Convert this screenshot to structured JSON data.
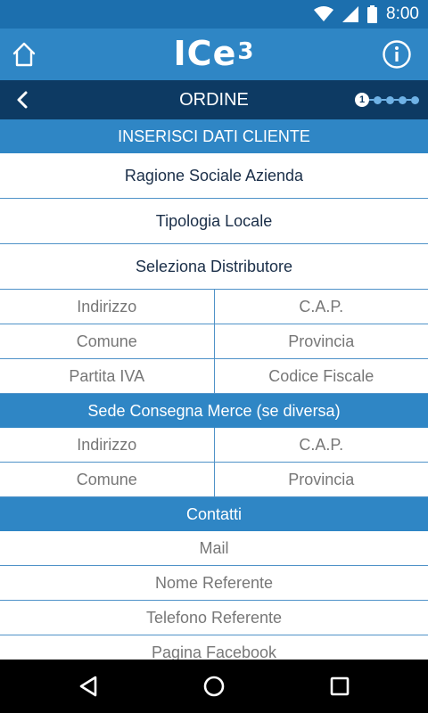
{
  "status_bar": {
    "time": "8:00"
  },
  "app_bar": {
    "logo_text": "ICe",
    "logo_sup": "3"
  },
  "nav_bar": {
    "title": "ORDINE",
    "back_symbol": "<",
    "step_current": "1"
  },
  "sections": {
    "cliente": {
      "header": "INSERISCI DATI CLIENTE",
      "rows_full": [
        "Ragione Sociale Azienda",
        "Tipologia Locale",
        "Seleziona Distributore"
      ],
      "rows_split": [
        [
          "Indirizzo",
          "C.A.P."
        ],
        [
          "Comune",
          "Provincia"
        ],
        [
          "Partita IVA",
          "Codice Fiscale"
        ]
      ]
    },
    "sede": {
      "header": "Sede Consegna Merce (se diversa)",
      "rows_split": [
        [
          "Indirizzo",
          "C.A.P."
        ],
        [
          "Comune",
          "Provincia"
        ]
      ]
    },
    "contatti": {
      "header": "Contatti",
      "rows": [
        "Mail",
        "Nome Referente",
        "Telefono Referente",
        "Pagina Facebook"
      ]
    }
  },
  "colors": {
    "status_bar": "#1c6fae",
    "app_bar": "#2f86c5",
    "nav_bar": "#0d3a63",
    "section_header": "#2f86c5",
    "divider": "#4f92c8"
  }
}
